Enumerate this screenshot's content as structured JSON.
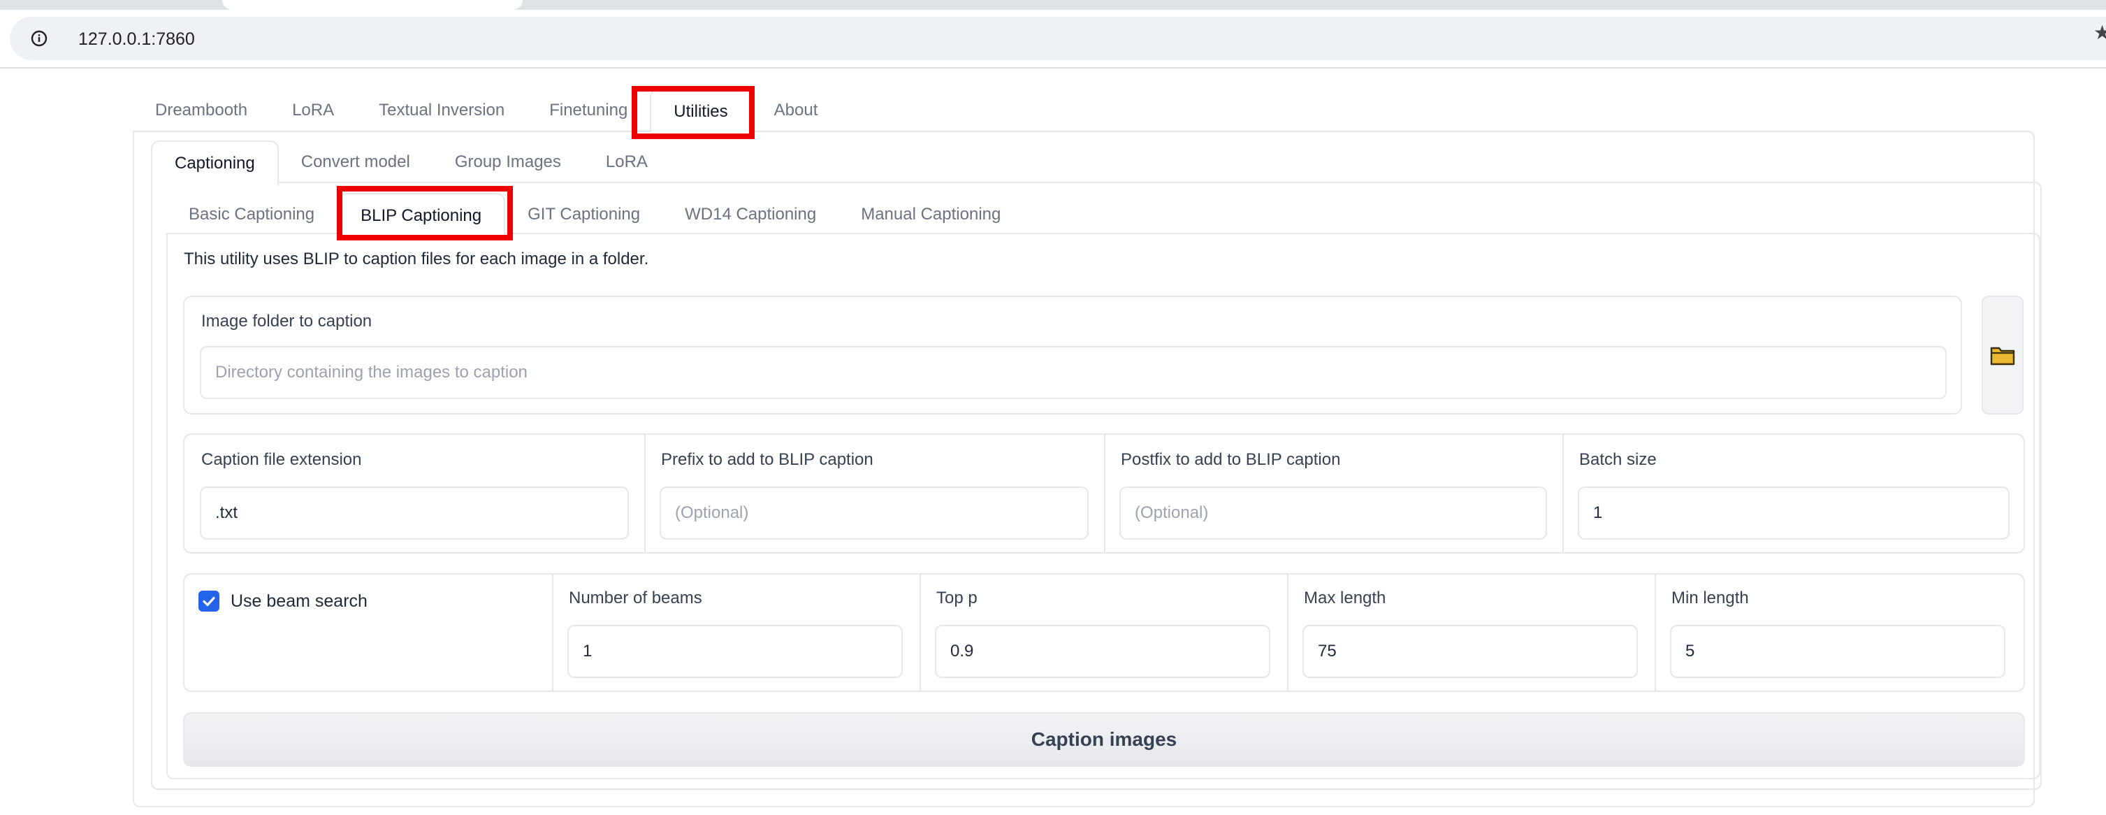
{
  "browser": {
    "url": "127.0.0.1:7860",
    "info_icon": "info-icon",
    "star_icon": "star-icon"
  },
  "main_tabs": [
    {
      "label": "Dreambooth"
    },
    {
      "label": "LoRA"
    },
    {
      "label": "Textual Inversion"
    },
    {
      "label": "Finetuning"
    },
    {
      "label": "Utilities"
    },
    {
      "label": "About"
    }
  ],
  "main_tabs_active": "Utilities",
  "utility_tabs": [
    {
      "label": "Captioning"
    },
    {
      "label": "Convert model"
    },
    {
      "label": "Group Images"
    },
    {
      "label": "LoRA"
    }
  ],
  "utility_tabs_active": "Captioning",
  "caption_tabs": [
    {
      "label": "Basic Captioning"
    },
    {
      "label": "BLIP Captioning"
    },
    {
      "label": "GIT Captioning"
    },
    {
      "label": "WD14 Captioning"
    },
    {
      "label": "Manual Captioning"
    }
  ],
  "caption_tabs_active": "BLIP Captioning",
  "blip": {
    "description": "This utility uses BLIP to caption files for each image in a folder.",
    "image_folder": {
      "label": "Image folder to caption",
      "placeholder": "Directory containing the images to caption",
      "icon": "folder-icon"
    },
    "caption_extension": {
      "label": "Caption file extension",
      "value": ".txt"
    },
    "prefix": {
      "label": "Prefix to add to BLIP caption",
      "placeholder": "(Optional)"
    },
    "postfix": {
      "label": "Postfix to add to BLIP caption",
      "placeholder": "(Optional)"
    },
    "batch_size": {
      "label": "Batch size",
      "value": "1"
    },
    "beam_search": {
      "label": "Use beam search",
      "checked": true
    },
    "num_beams": {
      "label": "Number of beams",
      "value": "1"
    },
    "top_p": {
      "label": "Top p",
      "value": "0.9"
    },
    "max_length": {
      "label": "Max length",
      "value": "75"
    },
    "min_length": {
      "label": "Min length",
      "value": "5"
    },
    "submit_label": "Caption images"
  },
  "colors": {
    "highlight": "#ee0000",
    "checkbox": "#2563eb",
    "folder": "#e8b931"
  }
}
